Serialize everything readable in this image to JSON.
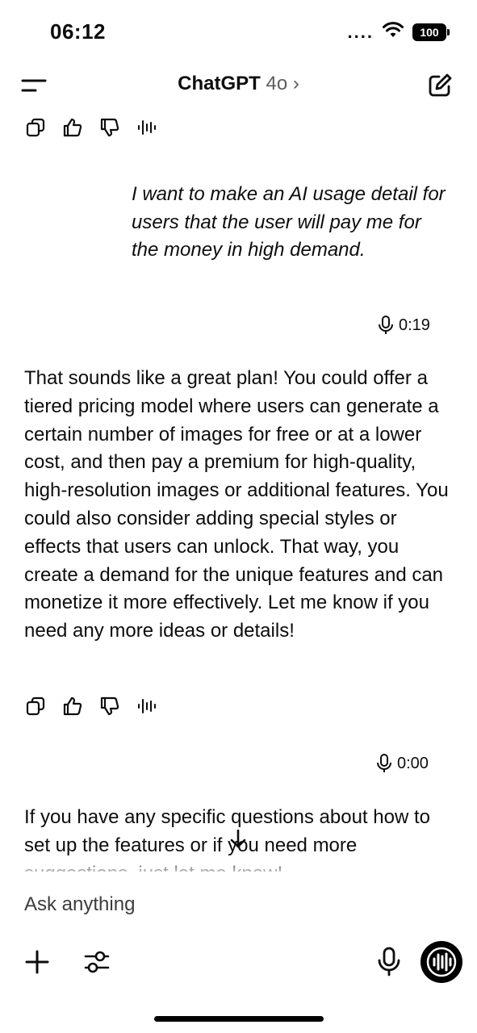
{
  "status_bar": {
    "time": "06:12",
    "signal": "....",
    "battery": "100"
  },
  "header": {
    "title": "ChatGPT",
    "model": "4o",
    "chevron": "›"
  },
  "user_message": {
    "text": "I want to make an AI usage detail for users that the user will pay me for the money in high demand.",
    "duration": "0:19"
  },
  "assistant_message_1": {
    "text": "That sounds like a great plan! You could offer a tiered pricing model where users can generate a certain number of images for free or at a lower cost, and then pay a premium for high-quality, high-resolution images or additional features. You could also consider adding special styles or effects that users can unlock. That way, you create a demand for the unique features and can monetize it more effectively. Let me know if you need any more ideas or details!"
  },
  "voice_message_2": {
    "duration": "0:00"
  },
  "assistant_message_2": {
    "text": "If you have any specific questions about how to set up the features or if you need more suggestions, just let me know!"
  },
  "composer": {
    "placeholder": "Ask anything"
  },
  "icons": {
    "menu": "menu-icon",
    "new_chat": "compose-icon",
    "copy": "copy-icon",
    "thumbs_up": "thumbs-up-icon",
    "thumbs_down": "thumbs-down-icon",
    "read_aloud": "waveform-icon",
    "mic": "mic-icon",
    "plus": "plus-icon",
    "tools": "sliders-icon",
    "scroll_down": "arrow-down-icon",
    "voice_mode": "voice-mode-icon"
  },
  "colors": {
    "text": "#0d0d0d",
    "muted": "#5d5d5d",
    "background": "#ffffff",
    "accent": "#000000"
  }
}
